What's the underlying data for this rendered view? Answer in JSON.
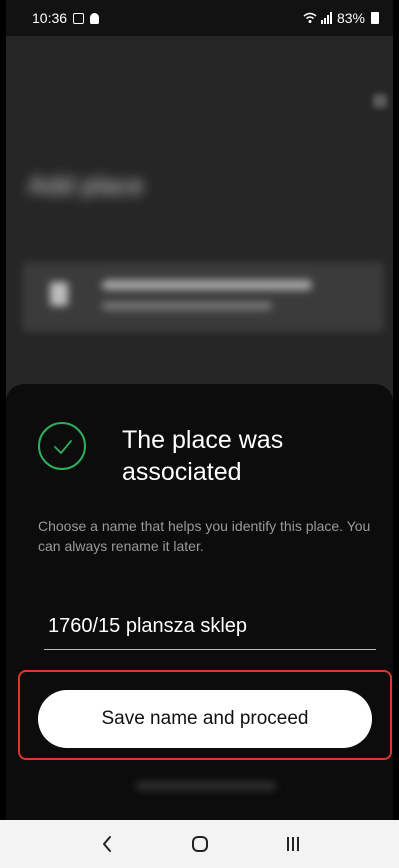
{
  "status_bar": {
    "time": "10:36",
    "battery": "83%"
  },
  "background": {
    "title": "Add place",
    "card_title": "Scanning the QR code",
    "card_subtitle": "Link place to profile"
  },
  "sheet": {
    "title": "The place was associated",
    "description": "Choose a name that helps you identify this place. You can always rename it later.",
    "name_value": "1760/15 plansza sklep",
    "save_button_label": "Save name and proceed"
  },
  "colors": {
    "success": "#2fae5b",
    "highlight": "#d63a2b",
    "sheet_bg": "#0c0c0c"
  },
  "nav_bar": {
    "icons": [
      "back-icon",
      "home-icon",
      "recents-icon"
    ]
  }
}
